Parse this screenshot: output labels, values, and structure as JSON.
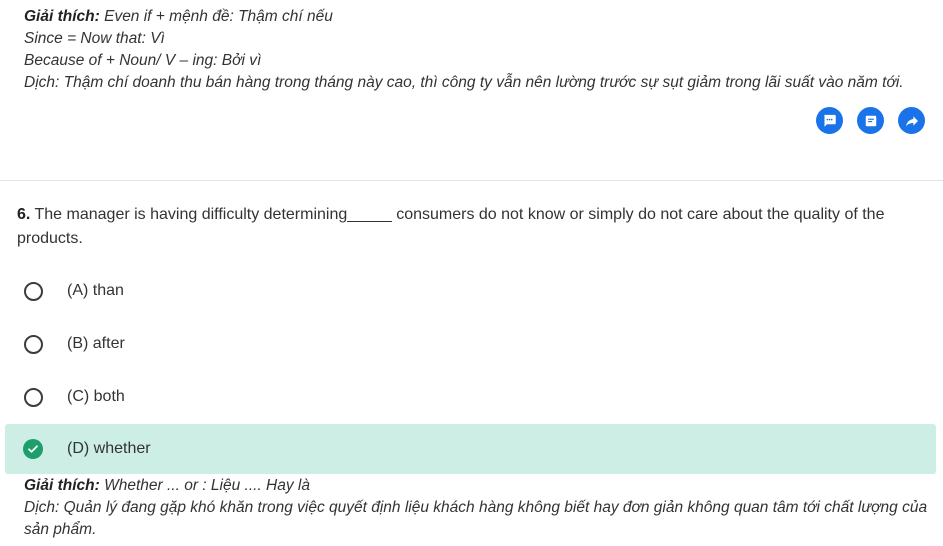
{
  "previous": {
    "expl_label": "Giải thích:",
    "expl_text": " Even if + mệnh đề: Thậm chí nếu",
    "line2": "Since = Now that: Vì",
    "line3": "Because of + Noun/ V – ing: Bởi vì",
    "line4": "Dịch: Thậm chí doanh thu bán hàng trong tháng này cao, thì công ty vẫn nên lường trước sự sụt giảm trong lãi suất vào năm tới."
  },
  "question": {
    "number": "6.",
    "text": " The manager is having difficulty determining_____ consumers do not know or simply do not care about the quality of the products."
  },
  "options": [
    {
      "label": "(A) than"
    },
    {
      "label": "(B) after"
    },
    {
      "label": "(C) both"
    },
    {
      "label": "(D) whether"
    }
  ],
  "explanation": {
    "label": "Giải thích:",
    "text": " Whether ... or : Liệu .... Hay là",
    "translation": "Dịch: Quản lý đang gặp khó khăn trong việc quyết định liệu khách hàng không biết hay đơn giản không quan tâm tới chất lượng của sản phẩm."
  },
  "colors": {
    "accent": "#1a73e8",
    "correct_bg": "#cdeee4",
    "correct_check": "#1e9e6a"
  },
  "icons": [
    "comment-icon",
    "note-icon",
    "share-icon",
    "radio-icon",
    "check-circle-icon"
  ]
}
